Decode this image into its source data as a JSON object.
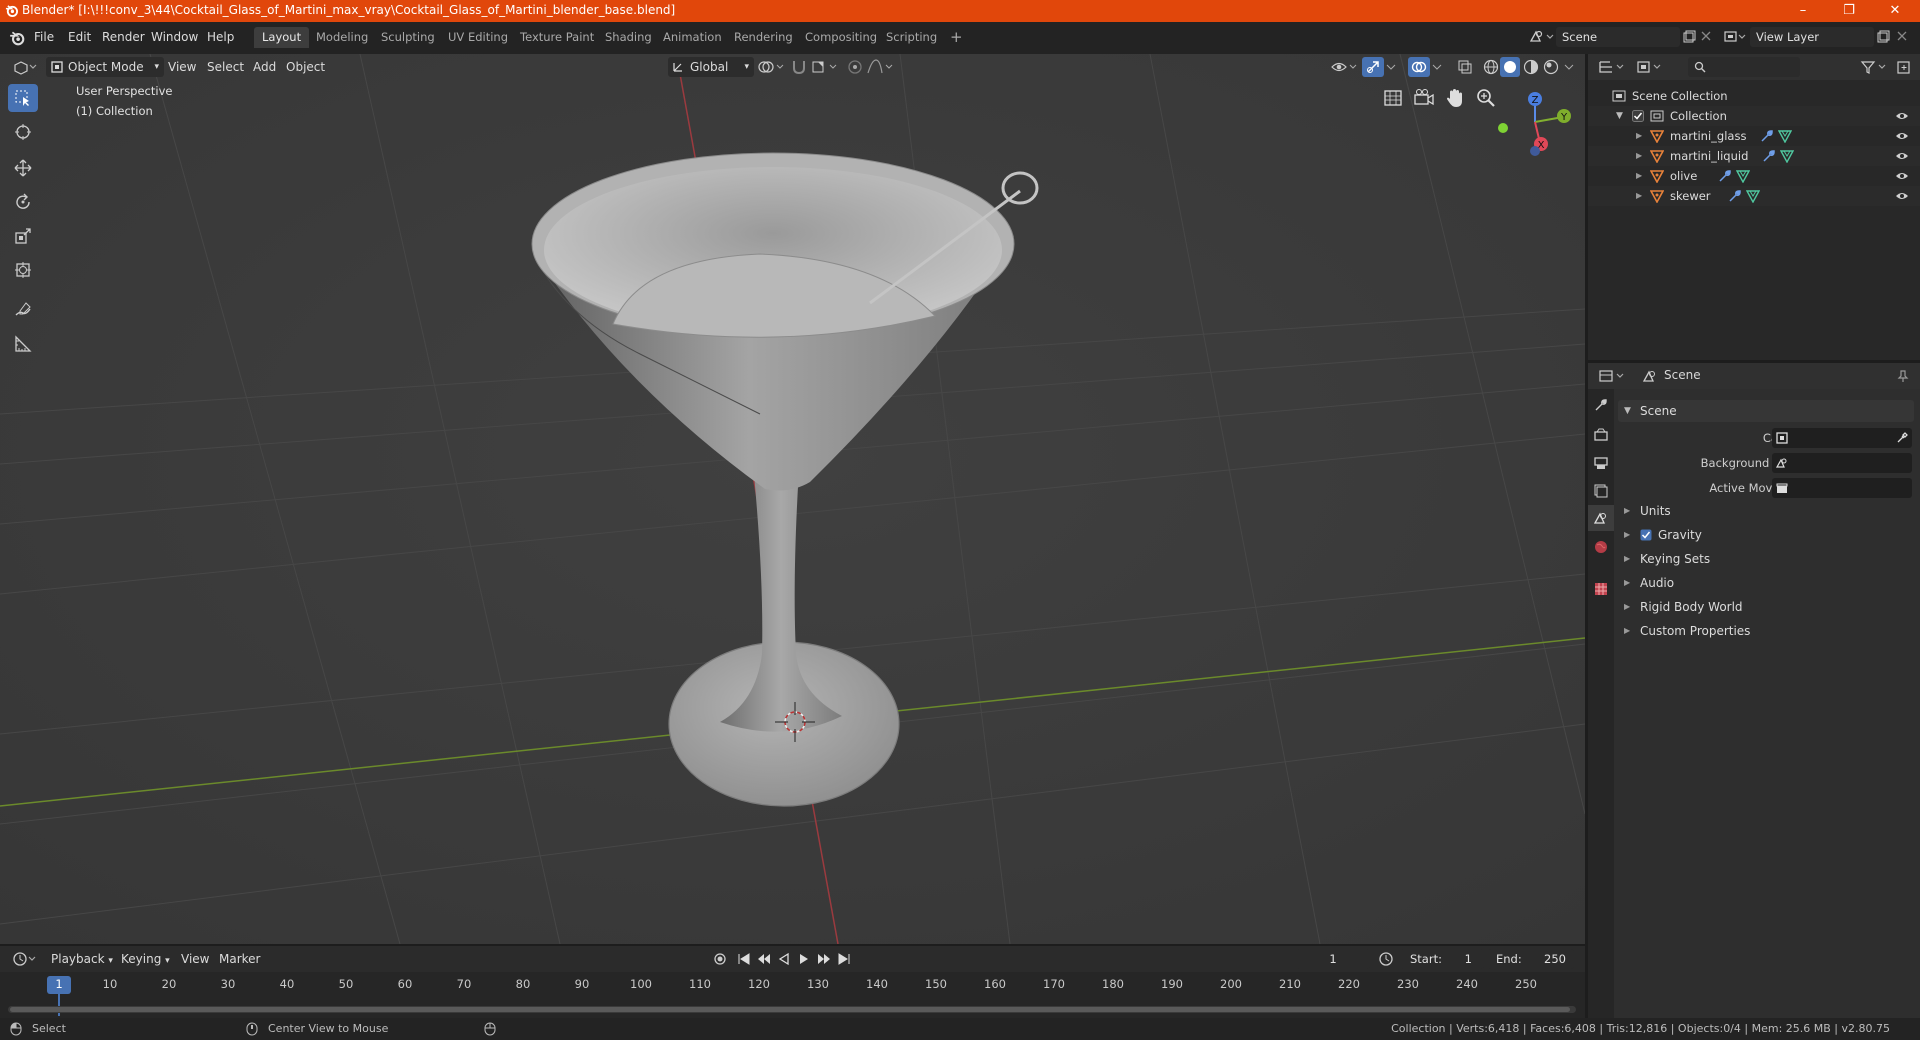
{
  "window": {
    "title": "Blender* [I:\\!!!conv_3\\44\\Cocktail_Glass_of_Martini_max_vray\\Cocktail_Glass_of_Martini_blender_base.blend]",
    "minimize": "–",
    "maximize": "❐",
    "close": "✕"
  },
  "menu": {
    "items": [
      "File",
      "Edit",
      "Render",
      "Window",
      "Help"
    ]
  },
  "workspaces": {
    "tabs": [
      "Layout",
      "Modeling",
      "Sculpting",
      "UV Editing",
      "Texture Paint",
      "Shading",
      "Animation",
      "Rendering",
      "Compositing",
      "Scripting"
    ],
    "active": "Layout",
    "add": "+"
  },
  "scene_selector": {
    "value": "Scene"
  },
  "view_layer_selector": {
    "value": "View Layer"
  },
  "viewport": {
    "mode": "Object Mode",
    "menus": [
      "View",
      "Select",
      "Add",
      "Object"
    ],
    "orientation": "Global",
    "overlay_text": {
      "perspective": "User Perspective",
      "collection": "(1) Collection"
    },
    "gizmo": {
      "z": "Z",
      "y": "Y",
      "x": "X"
    }
  },
  "outliner": {
    "search_placeholder": "",
    "root": "Scene Collection",
    "collection": "Collection",
    "objects": [
      "martini_glass",
      "martini_liquid",
      "olive",
      "skewer"
    ]
  },
  "properties": {
    "header": "Scene",
    "section": "Scene",
    "fields": {
      "camera_label": "Camera",
      "background_scene_label": "Background Scene",
      "active_movie_clip_label": "Active Movie Clip"
    },
    "panels": [
      "Units",
      "Gravity",
      "Keying Sets",
      "Audio",
      "Rigid Body World",
      "Custom Properties"
    ],
    "gravity_enabled": true
  },
  "timeline": {
    "menus": [
      "Playback",
      "Keying",
      "View",
      "Marker"
    ],
    "current_frame": "1",
    "start_label": "Start:",
    "start": "1",
    "end_label": "End:",
    "end": "250",
    "frame_labels": [
      "1",
      "10",
      "20",
      "30",
      "40",
      "50",
      "60",
      "70",
      "80",
      "90",
      "100",
      "110",
      "120",
      "130",
      "140",
      "150",
      "160",
      "170",
      "180",
      "190",
      "200",
      "210",
      "220",
      "230",
      "240",
      "250"
    ]
  },
  "status": {
    "left_action": "Select",
    "middle_action": "Center View to Mouse",
    "stats": "Collection | Verts:6,418 | Faces:6,408 | Tris:12,816 | Objects:0/4 | Mem: 25.6 MB | v2.80.75"
  },
  "colors": {
    "accent": "#4772b3",
    "titlebar": "#e1470b",
    "x_axis": "#b43c46",
    "y_axis": "#7fa33a",
    "object_icon": "#e8823a",
    "modifier_icon": "#6f9ee8",
    "mesh_icon": "#50c8a0"
  }
}
